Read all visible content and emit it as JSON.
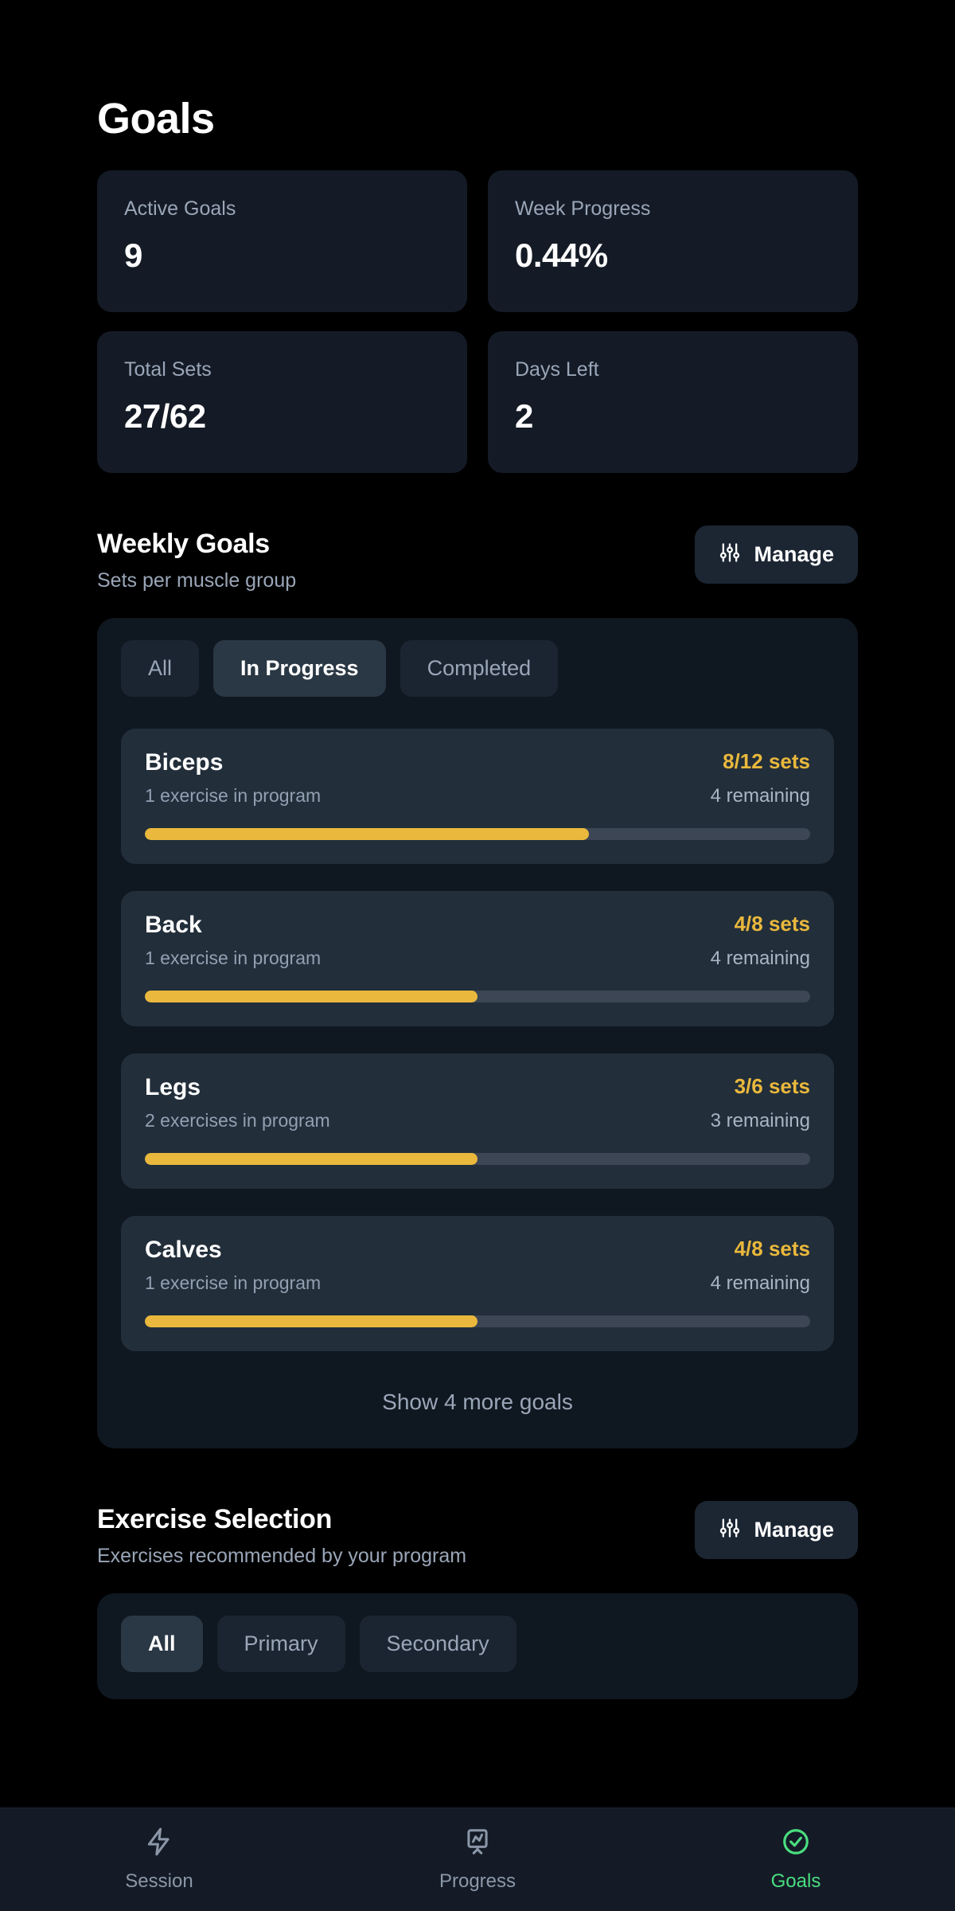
{
  "page": {
    "title": "Goals"
  },
  "stats": [
    {
      "label": "Active Goals",
      "value": "9"
    },
    {
      "label": "Week Progress",
      "value": "0.44%"
    },
    {
      "label": "Total Sets",
      "value": "27/62"
    },
    {
      "label": "Days Left",
      "value": "2"
    }
  ],
  "weekly_goals": {
    "title": "Weekly Goals",
    "subtitle": "Sets per muscle group",
    "manage_label": "Manage",
    "manage_icon": "sliders-icon",
    "tabs": [
      {
        "label": "All",
        "active": false
      },
      {
        "label": "In Progress",
        "active": true
      },
      {
        "label": "Completed",
        "active": false
      }
    ],
    "goals": [
      {
        "name": "Biceps",
        "exercises": "1 exercise in program",
        "sets": "8/12 sets",
        "remaining": "4 remaining",
        "completed": 8,
        "target": 12,
        "percent": 66.7
      },
      {
        "name": "Back",
        "exercises": "1 exercise in program",
        "sets": "4/8 sets",
        "remaining": "4 remaining",
        "completed": 4,
        "target": 8,
        "percent": 50
      },
      {
        "name": "Legs",
        "exercises": "2 exercises in program",
        "sets": "3/6 sets",
        "remaining": "3 remaining",
        "completed": 3,
        "target": 6,
        "percent": 50
      },
      {
        "name": "Calves",
        "exercises": "1 exercise in program",
        "sets": "4/8 sets",
        "remaining": "4 remaining",
        "completed": 4,
        "target": 8,
        "percent": 50
      }
    ],
    "show_more_label": "Show 4 more goals"
  },
  "exercise_selection": {
    "title": "Exercise Selection",
    "subtitle": "Exercises recommended by your program",
    "manage_label": "Manage",
    "manage_icon": "sliders-icon",
    "tabs": [
      {
        "label": "All",
        "active": true
      },
      {
        "label": "Primary",
        "active": false
      },
      {
        "label": "Secondary",
        "active": false
      }
    ]
  },
  "bottom_nav": [
    {
      "label": "Session",
      "icon": "lightning-bolt-icon",
      "active": false
    },
    {
      "label": "Progress",
      "icon": "presentation-chart-icon",
      "active": false
    },
    {
      "label": "Goals",
      "icon": "check-circle-icon",
      "active": true
    }
  ],
  "colors": {
    "accent_amber": "#eab83c",
    "accent_green": "#4ade80",
    "background": "#000000",
    "card": "#141b26",
    "goal_card": "#222e3a",
    "progress_track": "#3c4654"
  }
}
